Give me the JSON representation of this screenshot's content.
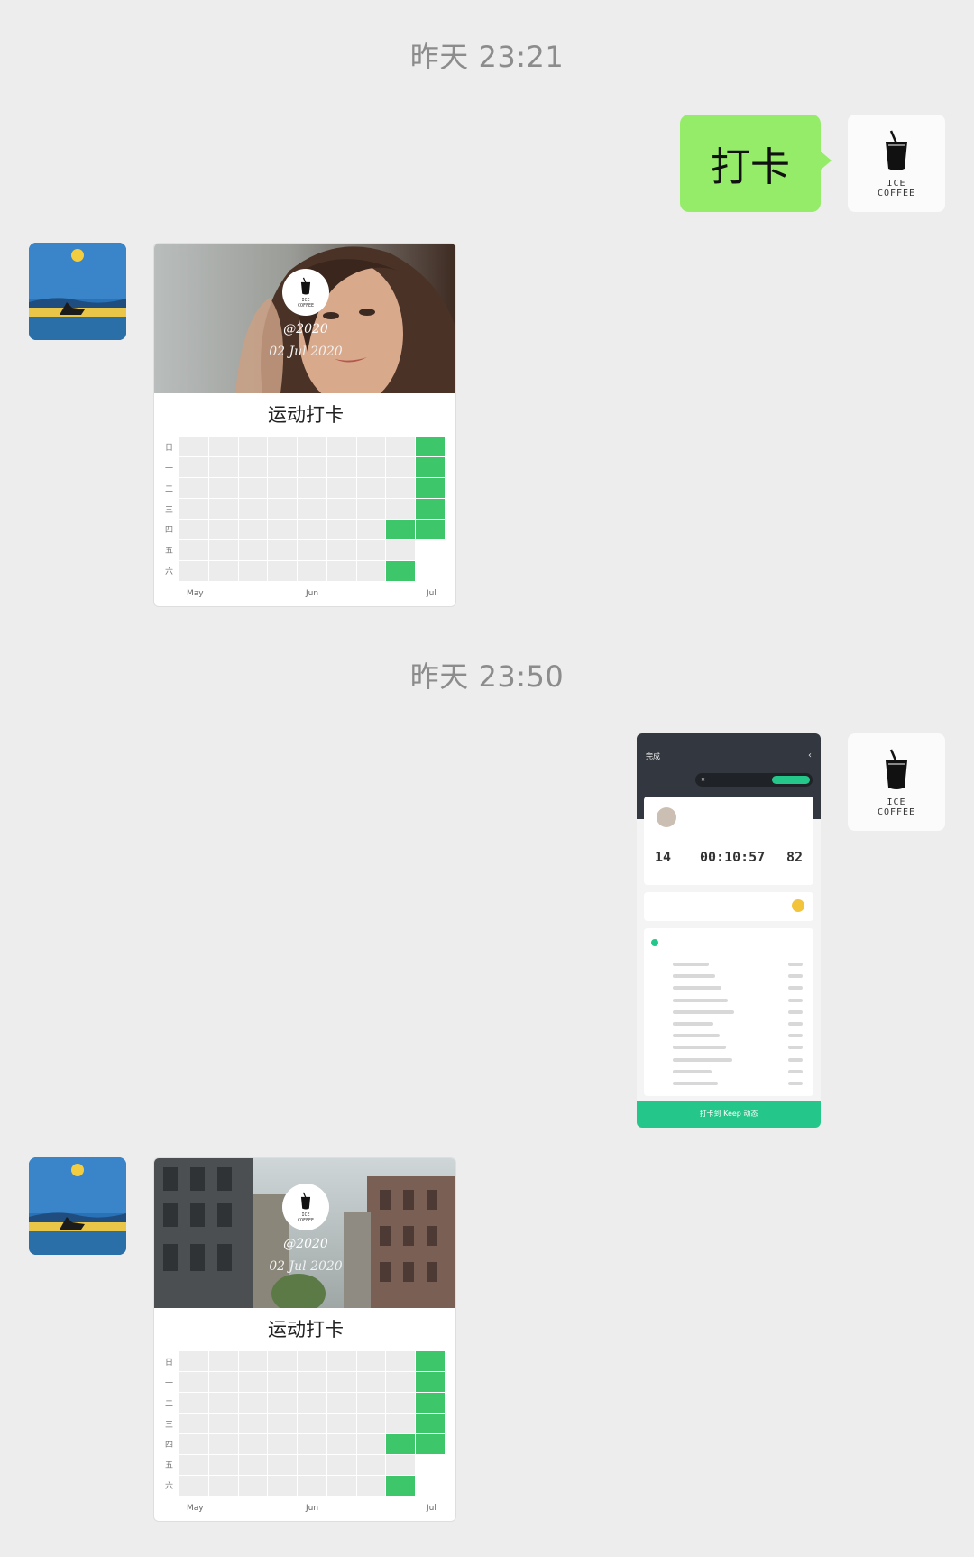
{
  "timestamps": [
    "昨天 23:21",
    "昨天 23:50"
  ],
  "messages": {
    "text_bubble": "打卡"
  },
  "coffee_avatar": {
    "line1": "ICE",
    "line2": "COFFEE"
  },
  "cards": [
    {
      "handle": "@2020",
      "date": "02 Jul 2020",
      "title": "运动打卡",
      "photo": "portrait-woman"
    },
    {
      "handle": "@2020",
      "date": "02 Jul 2020",
      "title": "运动打卡",
      "photo": "city-street"
    }
  ],
  "heatmap": {
    "day_labels": [
      "日",
      "一",
      "二",
      "三",
      "四",
      "五",
      "六"
    ],
    "month_labels": [
      "May",
      "Jun",
      "Jul"
    ],
    "columns": 9,
    "active_cells": [
      [
        0,
        8
      ],
      [
        1,
        8
      ],
      [
        2,
        8
      ],
      [
        3,
        8
      ],
      [
        4,
        7
      ],
      [
        4,
        8
      ],
      [
        6,
        7
      ]
    ],
    "blank_cells": [
      [
        5,
        8
      ],
      [
        6,
        8
      ]
    ],
    "active_color": "#3dc76a"
  },
  "keep_screenshot": {
    "title": "完成",
    "stats": [
      "14",
      "00:10:57",
      "82"
    ],
    "footer": "打卡到 Keep 动态"
  },
  "colors": {
    "bubble_green": "#95ec69",
    "background": "#ededed",
    "keep_green": "#24c789"
  }
}
